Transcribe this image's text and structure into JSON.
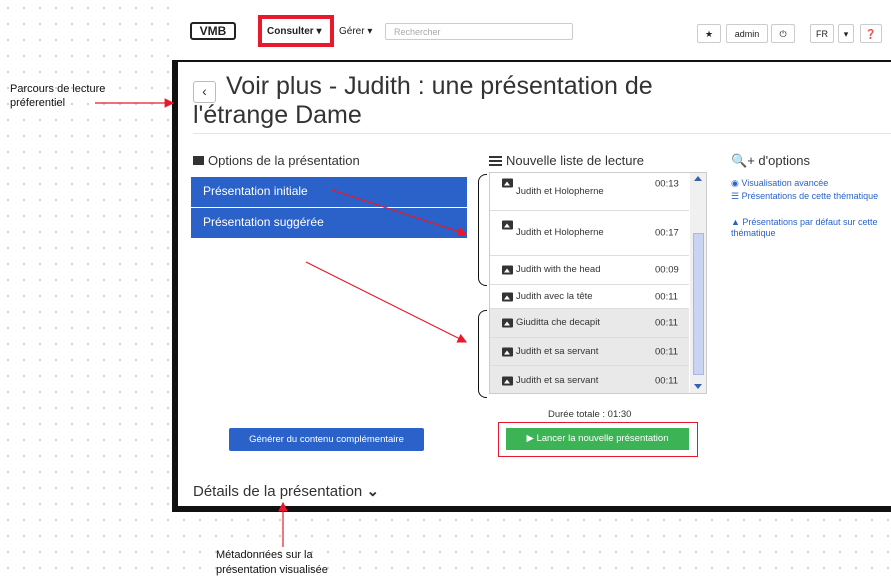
{
  "annotations": {
    "preferred_path": "Parcours de lecture préferentiel",
    "metadata_note_line1": "Métadonnées sur la",
    "metadata_note_line2": "présentation visualisée"
  },
  "navbar": {
    "logo": "VMB",
    "consulter": "Consulter ▾",
    "gerer": "Gérer ▾",
    "search_placeholder": "Rechercher",
    "star": "★",
    "user": "admin",
    "power": "⏻",
    "lang": "FR",
    "lang_caret": "▾",
    "help": "❓"
  },
  "page": {
    "back": "‹",
    "title": "Voir plus - Judith : une présentation de l'étrange Dame"
  },
  "options": {
    "heading": "Options de la présentation",
    "initial": "Présentation initiale",
    "suggested": "Présentation suggérée"
  },
  "playlist": {
    "heading": "Nouvelle liste de lecture",
    "items": [
      {
        "name": "Judith et Holopherne",
        "duration": "00:13"
      },
      {
        "name": "Judith et Holopherne",
        "duration": "00:17"
      },
      {
        "name": "Judith with the head",
        "duration": "00:09"
      },
      {
        "name": "Judith avec la tête",
        "duration": "00:11"
      },
      {
        "name": "Giuditta che decapit",
        "duration": "00:11"
      },
      {
        "name": "Judith et sa servant",
        "duration": "00:11"
      },
      {
        "name": "Judith et sa servant",
        "duration": "00:11"
      }
    ],
    "total": "Durée totale : 01:30",
    "launch": "▶ Lancer la nouvelle présentation"
  },
  "more": {
    "heading": "+ d'options",
    "advanced": "Visualisation avancée",
    "theme_presentations": "Présentations de cette thématique",
    "default_presentations": "Présentations par défaut sur cette thématique"
  },
  "generate": "Générer du contenu complémentaire",
  "details": "Détails de la présentation"
}
